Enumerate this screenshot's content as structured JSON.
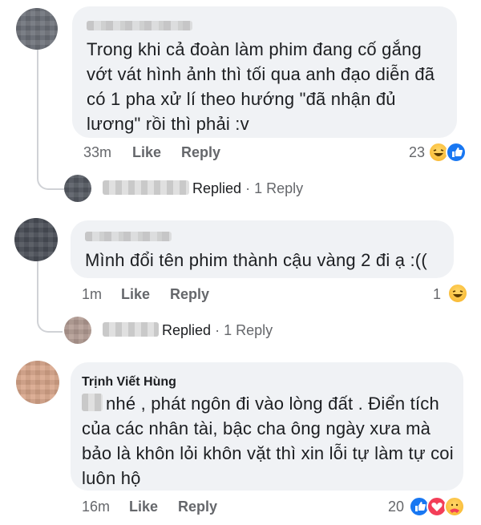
{
  "comments": [
    {
      "text": "Trong khi cả đoàn làm phim đang cố gắng vớt vát hình ảnh thì tối qua anh đạo diễn đã có 1 pha xử lí theo hướng \"đã nhận đủ lương\" rồi thì phải :v",
      "time": "33m",
      "like_label": "Like",
      "reply_label": "Reply",
      "reaction_count": "23",
      "reactions": [
        "haha-icon",
        "like-icon"
      ],
      "reply_summary": {
        "replied_label": "Replied",
        "separator": "·",
        "count_label": "1 Reply"
      }
    },
    {
      "text": "Mình đổi tên phim thành cậu vàng 2 đi ạ :((",
      "time": "1m",
      "like_label": "Like",
      "reply_label": "Reply",
      "reaction_count": "1",
      "reactions": [
        "haha-icon"
      ],
      "reply_summary": {
        "replied_label": "Replied",
        "separator": "·",
        "count_label": "1 Reply"
      }
    },
    {
      "author": "Trịnh Viết Hùng",
      "text": "nhé , phát ngôn đi vào lòng đất . Điển tích của các nhân tài, bậc cha ông ngày xưa mà bảo là khôn lỏi khôn vặt thì xin lỗi tự làm tự coi luôn hộ",
      "time": "16m",
      "like_label": "Like",
      "reply_label": "Reply",
      "reaction_count": "20",
      "reactions": [
        "like-icon",
        "love-icon",
        "care-icon"
      ]
    }
  ],
  "colors": {
    "bubble": "#f0f2f5",
    "meta": "#65676b",
    "like_blue": "#1877f2",
    "love_red": "#f33e58",
    "haha_yellow": "#f7b125"
  }
}
